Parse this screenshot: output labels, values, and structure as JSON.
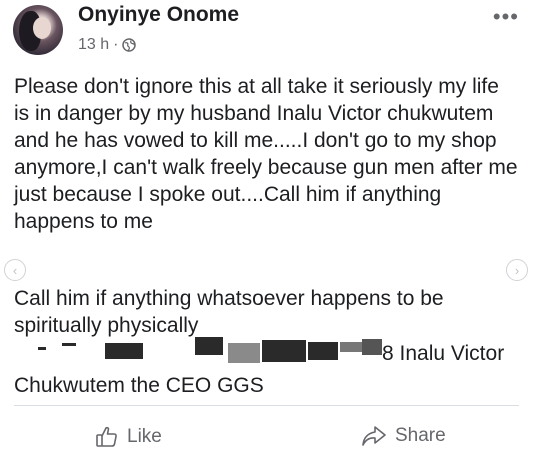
{
  "post": {
    "author": "Onyinye Onome",
    "time": "13 h",
    "separator": "·",
    "privacy_icon": "globe-icon",
    "more_icon": "more-options-icon",
    "paragraph1": "Please don't ignore this at all take it seriously my life is in danger by my husband Inalu Victor chukwutem and he has vowed to kill me.....I don't go to my shop anymore,I can't walk freely because gun men after me just because I spoke out....Call him if anything happens to me",
    "paragraph2": "Call him if anything whatsoever happens to be spiritually physically",
    "redacted_line_tail": "8 Inalu Victor",
    "last_line": "Chukwutem the CEO GGS"
  },
  "actions": {
    "like_label": "Like",
    "share_label": "Share"
  }
}
